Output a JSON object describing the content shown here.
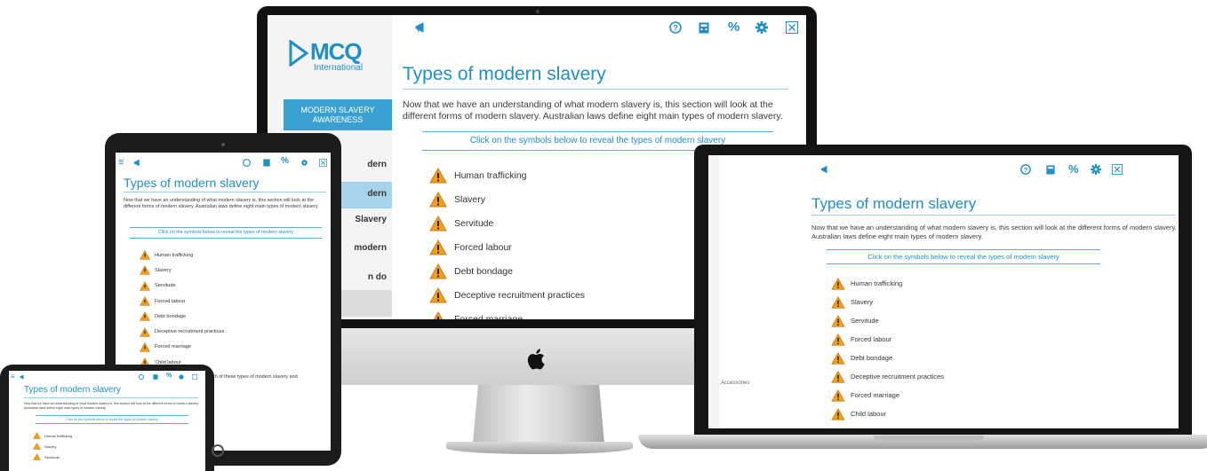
{
  "course": {
    "logo": {
      "brand": "MCQ",
      "sub": "International"
    },
    "title": "Types of modern slavery",
    "intro": "Now that we have an understanding of what modern slavery is, this section will look at the different forms of modern slavery. Australian laws define eight main types of modern slavery.",
    "instruction": "Click on the symbols below to reveal the types of modern slavery",
    "types": [
      "Human trafficking",
      "Slavery",
      "Servitude",
      "Forced labour",
      "Debt bondage",
      "Deceptive recruitment practices",
      "Forced marriage",
      "Child labour"
    ],
    "toolbar_icons": [
      "menu-icon",
      "announce-icon",
      "help-icon",
      "calculator-icon",
      "percent-icon",
      "gear-icon",
      "close-icon"
    ],
    "toolbar_percent": "%"
  },
  "sidebar": {
    "active_label": "MODERN SLAVERY AWARENESS",
    "item_fragments": [
      "dern",
      "dern",
      "Slavery",
      "modern",
      "n do"
    ]
  },
  "tablet_extra": {
    "outro_fragment": "ach of these types of modern slavery and"
  },
  "laptop_extra": {
    "sidebar_fragment": "Accessories"
  },
  "colors": {
    "accent": "#1f8fc4",
    "warning": "#f0a020"
  }
}
